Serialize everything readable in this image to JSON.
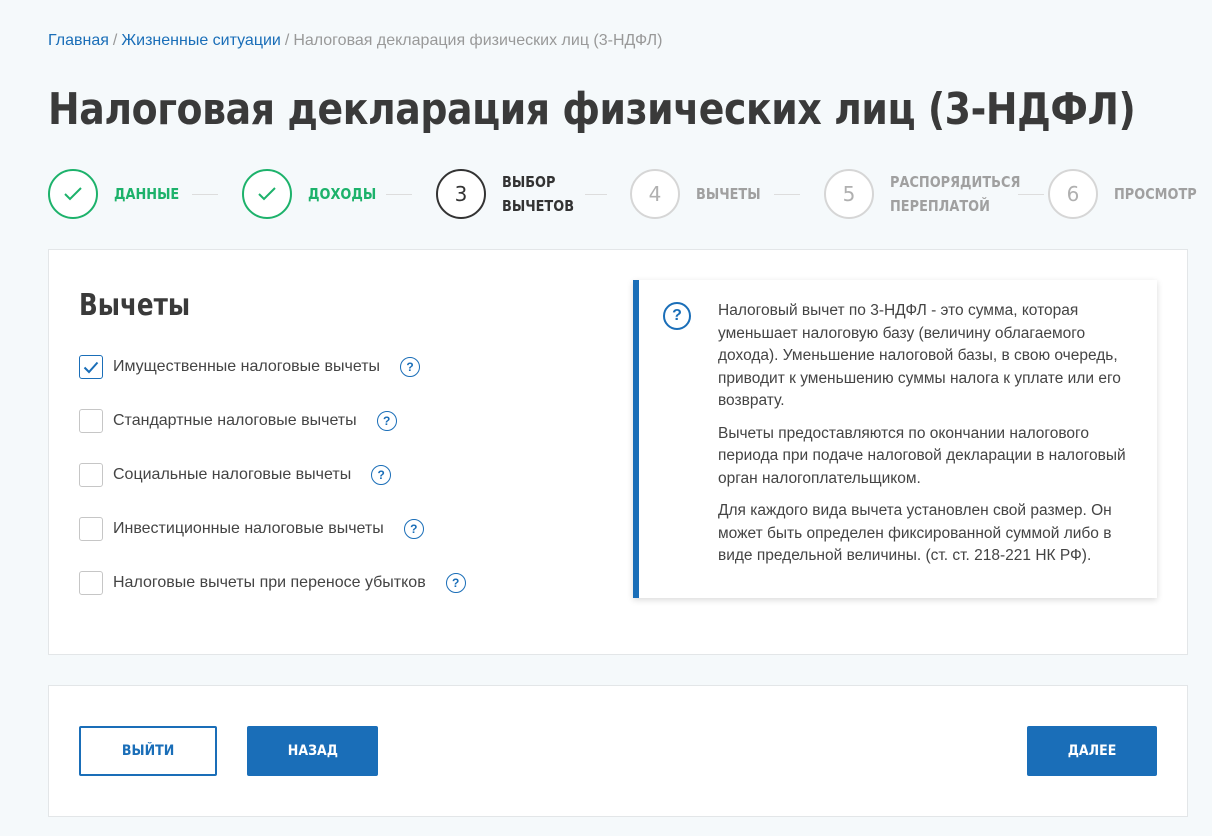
{
  "breadcrumb": {
    "items": [
      "Главная",
      "Жизненные ситуации"
    ],
    "separator": "/",
    "current": "Налоговая декларация физических лиц (3-НДФЛ)"
  },
  "page": {
    "title": "Налоговая декларация физических лиц (3-НДФЛ)"
  },
  "steps": [
    {
      "number": "1",
      "label": "Данные",
      "state": "done"
    },
    {
      "number": "2",
      "label": "Доходы",
      "state": "done"
    },
    {
      "number": "3",
      "label_line1": "Выбор",
      "label_line2": "вычетов",
      "state": "current"
    },
    {
      "number": "4",
      "label": "Вычеты",
      "state": "todo"
    },
    {
      "number": "5",
      "label_line1": "Распорядиться",
      "label_line2": "переплатой",
      "state": "todo"
    },
    {
      "number": "6",
      "label": "Просмотр",
      "state": "todo"
    }
  ],
  "deductions": {
    "title": "Вычеты",
    "options": [
      {
        "label": "Имущественные налоговые вычеты",
        "checked": true
      },
      {
        "label": "Стандартные налоговые вычеты",
        "checked": false
      },
      {
        "label": "Социальные налоговые вычеты",
        "checked": false
      },
      {
        "label": "Инвестиционные налоговые вычеты",
        "checked": false
      },
      {
        "label": "Налоговые вычеты при переносе убытков",
        "checked": false
      }
    ],
    "help_symbol": "?"
  },
  "info": {
    "icon_symbol": "?",
    "paragraphs": [
      "Налоговый вычет по 3-НДФЛ - это сумма, которая уменьшает налоговую базу (величину облагаемого дохода). Уменьшение налоговой базы, в свою очередь, приводит к уменьшению суммы налога к уплате или его возврату.",
      "Вычеты предоставляются по окончании налогового периода при подаче налоговой декларации в налоговый орган налогоплательщиком.",
      "Для каждого вида вычета установлен свой размер. Он может быть определен фиксированной суммой либо в виде предельной величины. (ст. ст. 218-221 НК РФ)."
    ]
  },
  "actions": {
    "exit_label": "Выйти",
    "back_label": "Назад",
    "next_label": "Далее"
  },
  "colors": {
    "accent": "#1a6eb8",
    "done": "#1db26b",
    "inactive": "#a0a0a0"
  }
}
